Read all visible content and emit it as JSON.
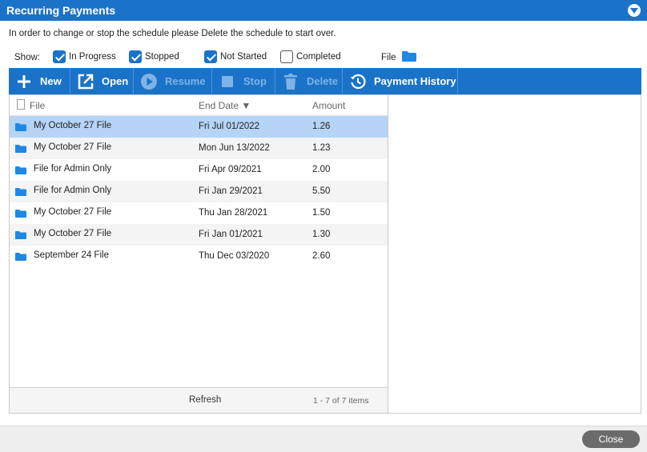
{
  "window": {
    "title": "Recurring Payments"
  },
  "info_text": "In order to change or stop the schedule please Delete the schedule to start over.",
  "filters": {
    "show_label": "Show:",
    "options": [
      {
        "label": "In Progress",
        "checked": true
      },
      {
        "label": "Stopped",
        "checked": true
      },
      {
        "label": "Not Started",
        "checked": true
      },
      {
        "label": "Completed",
        "checked": false
      }
    ],
    "file_label": "File",
    "file_value": ""
  },
  "toolbar": {
    "new": "New",
    "open": "Open",
    "resume": "Resume",
    "stop": "Stop",
    "delete": "Delete",
    "history": "Payment History"
  },
  "grid": {
    "columns": {
      "file": "File",
      "end_date": "End Date",
      "amount": "Amount"
    },
    "rows": [
      {
        "file": "My October 27 File",
        "end_date": "Fri Jul 01/2022",
        "amount": "1.26",
        "selected": true
      },
      {
        "file": "My October 27 File",
        "end_date": "Mon Jun 13/2022",
        "amount": "1.23"
      },
      {
        "file": "File for Admin Only",
        "end_date": "Fri Apr 09/2021",
        "amount": "2.00"
      },
      {
        "file": "File for Admin Only",
        "end_date": "Fri Jan 29/2021",
        "amount": "5.50"
      },
      {
        "file": "My October 27 File",
        "end_date": "Thu Jan 28/2021",
        "amount": "1.50"
      },
      {
        "file": "My October 27 File",
        "end_date": "Fri Jan 01/2021",
        "amount": "1.30"
      },
      {
        "file": "September 24 File",
        "end_date": "Thu Dec 03/2020",
        "amount": "2.60"
      }
    ],
    "refresh": "Refresh",
    "pager": "1 - 7 of 7 items"
  },
  "close_button": "Close",
  "colors": {
    "accent": "#1a73c9",
    "selected_row": "#b5d4f6",
    "folder": "#1e88e5"
  }
}
